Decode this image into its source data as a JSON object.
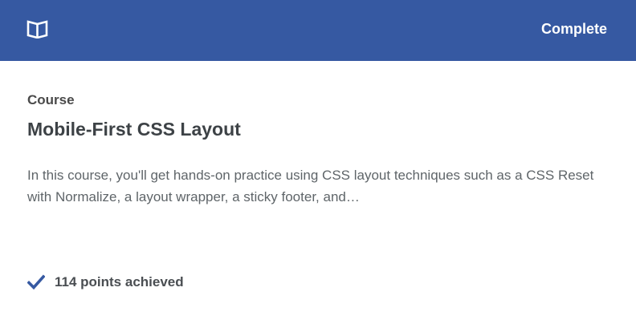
{
  "header": {
    "icon": "open-book-icon",
    "status_label": "Complete",
    "background_color": "#3659a2"
  },
  "content": {
    "type_label": "Course",
    "title": "Mobile-First CSS Layout",
    "description": "In this course, you'll get hands-on practice using CSS layout techniques such as a CSS Reset with Normalize, a layout wrapper, a sticky footer, and…"
  },
  "footer": {
    "icon": "checkmark-icon",
    "points_text": "114 points achieved",
    "accent_color": "#3659a2"
  }
}
